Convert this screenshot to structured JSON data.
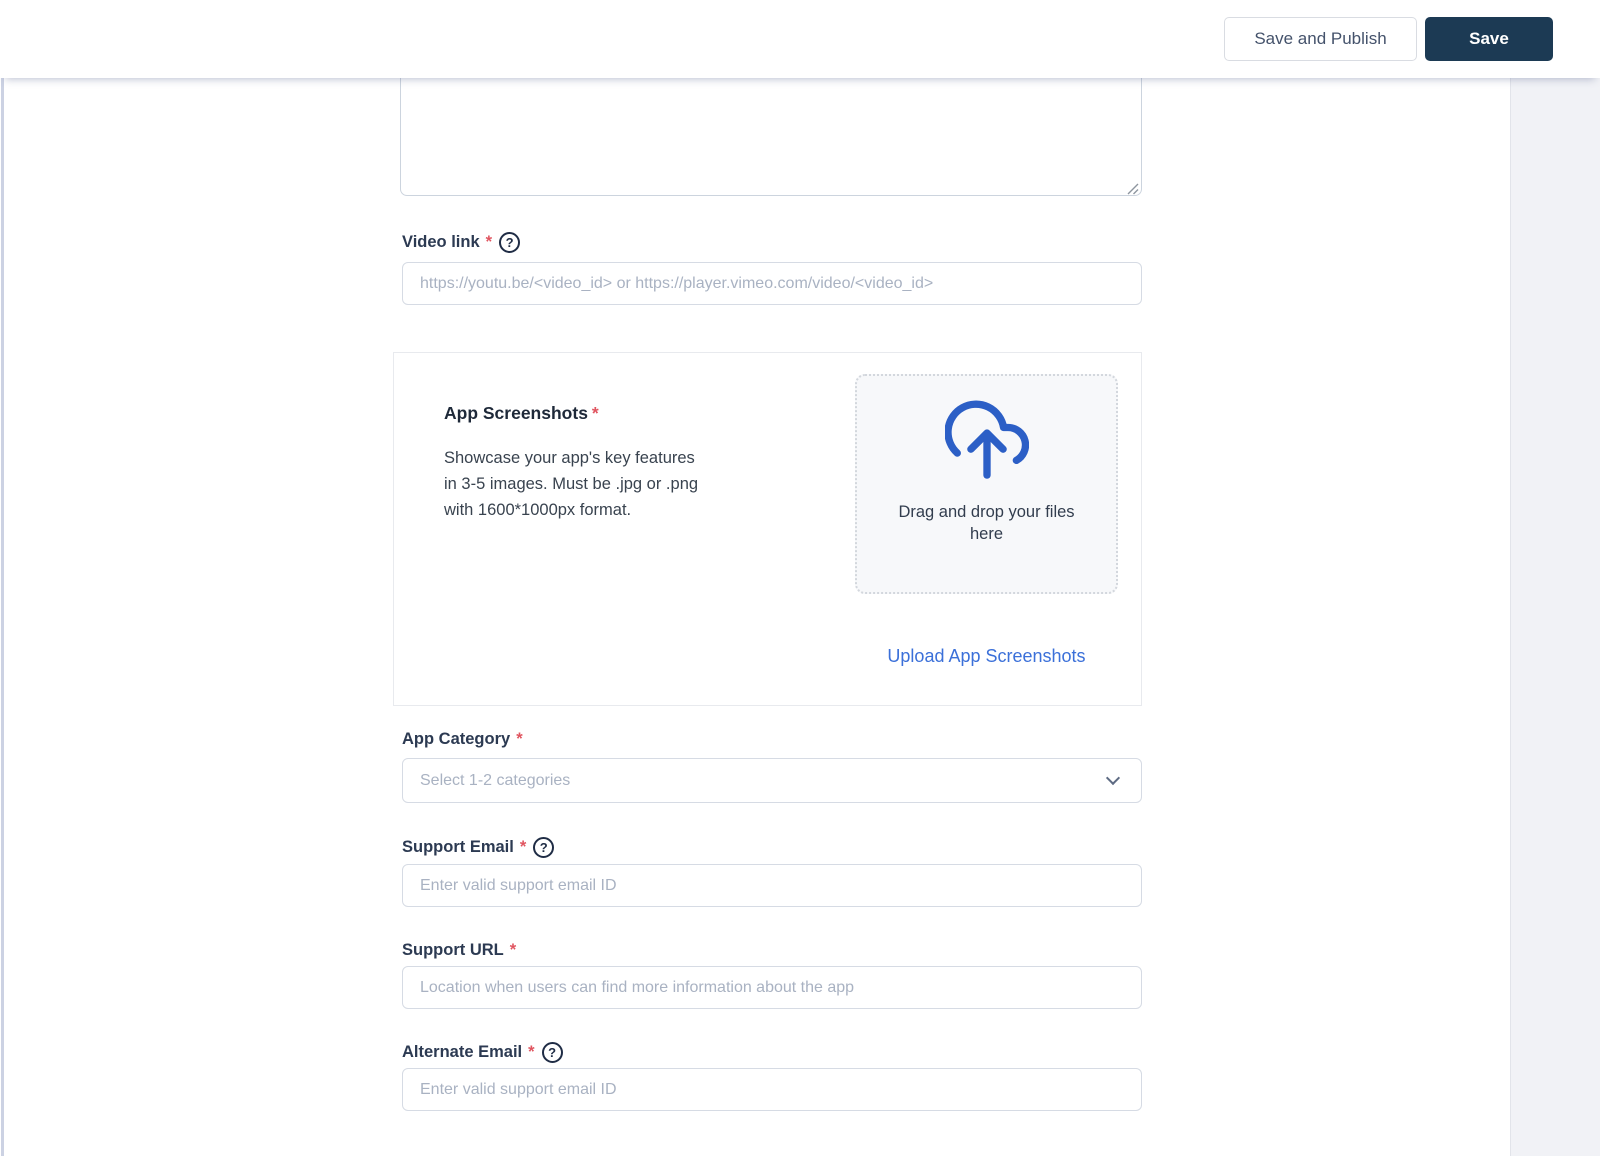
{
  "header": {
    "save_and_publish_button": "Save and Publish",
    "save_button": "Save"
  },
  "form": {
    "description_textarea": {
      "value": ""
    },
    "video_link": {
      "label": "Video link",
      "required": "*",
      "placeholder": "https://youtu.be/<video_id> or https://player.vimeo.com/video/<video_id>"
    },
    "app_screenshots": {
      "title": "App Screenshots",
      "required": "*",
      "description": "Showcase your app's key features in 3-5 images. Must be .jpg or .png with 1600*1000px format.",
      "dropzone_label": "Drag and drop your files here",
      "upload_link": "Upload App Screenshots"
    },
    "app_category": {
      "label": "App Category",
      "required": "*",
      "placeholder": "Select 1-2 categories"
    },
    "support_email": {
      "label": "Support Email",
      "required": "*",
      "placeholder": "Enter valid support email ID"
    },
    "support_url": {
      "label": "Support URL",
      "required": "*",
      "placeholder": "Location when users can find more information about the app"
    },
    "alternate_email": {
      "label": "Alternate Email",
      "required": "*",
      "placeholder": "Enter valid support email ID"
    }
  },
  "icons": {
    "help_glyph": "?"
  },
  "colors": {
    "accent_blue": "#2c5fc6",
    "link_blue": "#3b70d9",
    "save_button_bg": "#1c3a54",
    "required_red": "#e0545f",
    "side_panel_grey": "#f1f2f6"
  }
}
